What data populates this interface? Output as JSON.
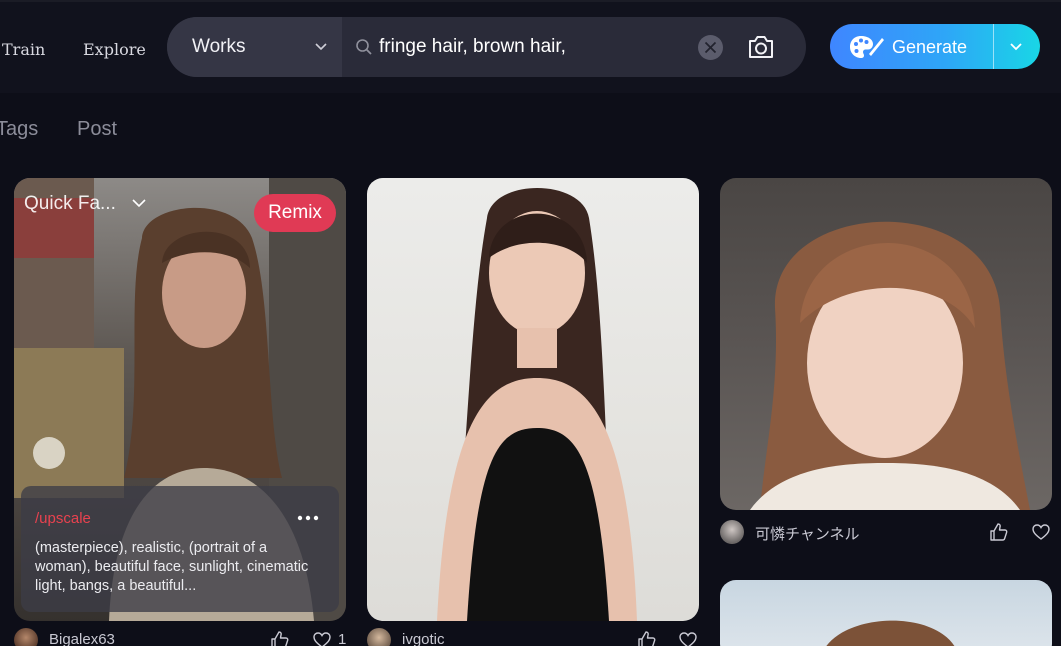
{
  "nav": {
    "train": "Train",
    "explore": "Explore"
  },
  "search": {
    "scope": "Works",
    "query": "fringe hair, brown hair,"
  },
  "generate": {
    "label": "Generate"
  },
  "tabs": {
    "tags": "Tags",
    "post": "Post"
  },
  "cards": [
    {
      "overlay_label": "Quick Fa...",
      "remix_label": "Remix",
      "prompt_command": "/upscale",
      "prompt_text": "(masterpiece), realistic, (portrait of a woman), beautiful face, sunlight, cinematic light, bangs, a beautiful...",
      "author": "Bigalex63",
      "likes": "1"
    },
    {
      "author": "ivgotic"
    },
    {
      "author": "可憐チャンネル"
    }
  ],
  "colors": {
    "background": "#0d0e18",
    "remix": "#e03a55",
    "command": "#e8424f",
    "generate_start": "#3f86ff",
    "generate_end": "#19d6e6"
  }
}
